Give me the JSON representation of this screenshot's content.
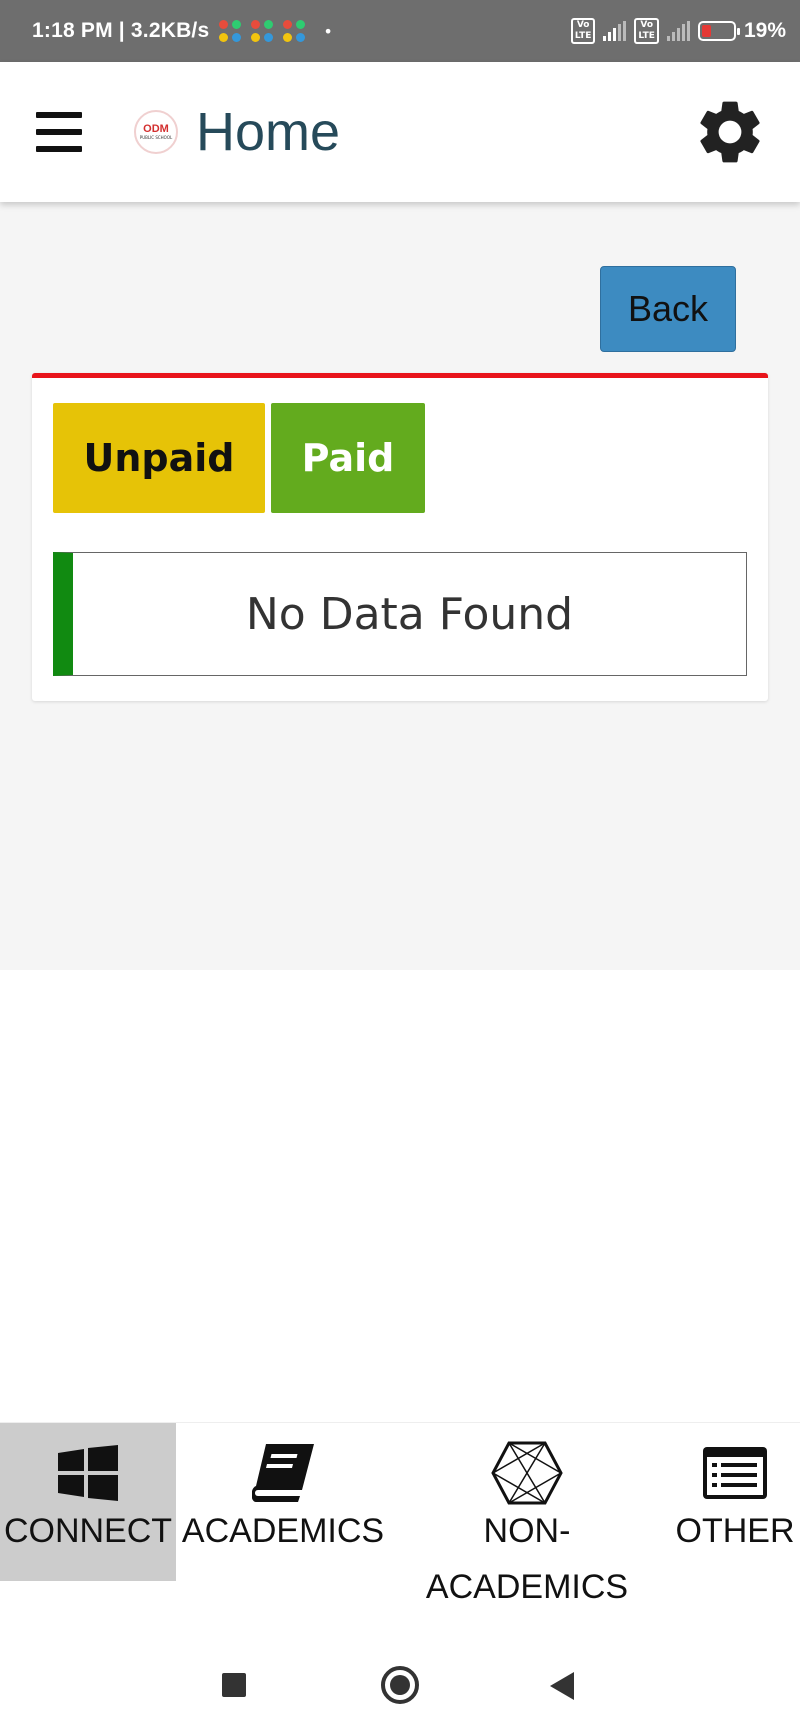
{
  "status_bar": {
    "time": "1:18 PM | 3.2KB/s",
    "dot": "•",
    "lte_label": "Vo\nLTE",
    "network_type": "4G",
    "battery_level": 19,
    "battery_pct": "19%",
    "battery_color": "#e53935"
  },
  "app_bar": {
    "title": "Home",
    "logo_text": "ODM",
    "logo_subtext": "PUBLIC SCHOOL",
    "menu_icon": "hamburger-icon",
    "settings_icon": "gear-icon"
  },
  "content": {
    "back_label": "Back",
    "card_accent": "#e8141b",
    "tabs": [
      {
        "label": "Unpaid",
        "color": "#e6c307"
      },
      {
        "label": "Paid",
        "color": "#63ab1e"
      }
    ],
    "empty_message": "No Data Found"
  },
  "bottom_nav": {
    "items": [
      {
        "label": "CONNECT",
        "icon": "windows-icon",
        "active": true
      },
      {
        "label": "ACADEMICS",
        "icon": "book-icon",
        "active": false
      },
      {
        "label": "NON-\nACADEMICS",
        "icon": "polyhedron-icon",
        "active": false
      },
      {
        "label": "OTHER",
        "icon": "list-icon",
        "active": false
      }
    ]
  },
  "system_nav": {
    "recents_icon": "square-icon",
    "home_icon": "circle-icon",
    "back_icon": "triangle-back-icon"
  }
}
